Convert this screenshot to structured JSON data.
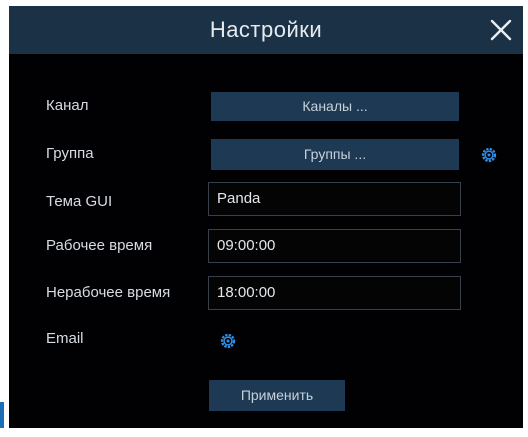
{
  "dialog": {
    "title": "Настройки"
  },
  "rows": {
    "channel_label": "Канал",
    "channel_button": "Каналы ...",
    "group_label": "Группа",
    "group_button": "Группы ...",
    "theme_label": "Тема GUI",
    "theme_value": "Panda",
    "work_time_label": "Рабочее время",
    "work_time_value": "09:00:00",
    "off_time_label": "Нерабочее время",
    "off_time_value": "18:00:00",
    "email_label": "Email"
  },
  "actions": {
    "apply_label": "Применить"
  },
  "icons": {
    "close": "close-icon",
    "group_settings": "gear-icon",
    "email_settings": "gear-icon"
  },
  "colors": {
    "titlebar": "#1b3146",
    "background": "#010103",
    "button": "#1d3953",
    "accent_icon": "#2f8ee8"
  }
}
